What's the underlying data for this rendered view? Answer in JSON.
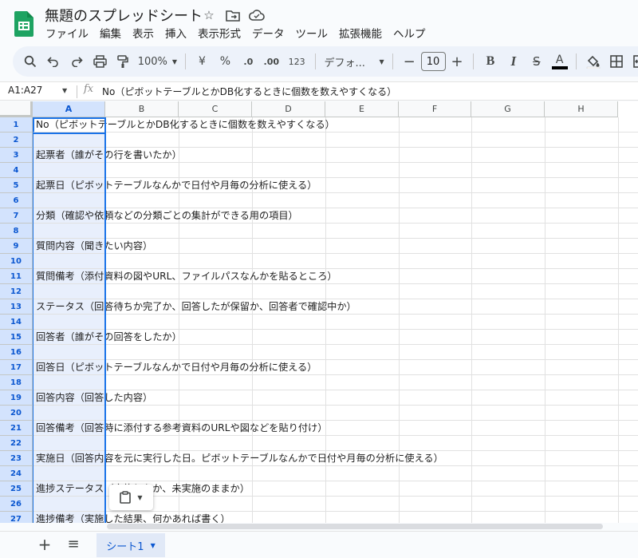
{
  "app": {
    "doc_title": "無題のスプレッドシート",
    "menu": [
      "ファイル",
      "編集",
      "表示",
      "挿入",
      "表示形式",
      "データ",
      "ツール",
      "拡張機能",
      "ヘルプ"
    ]
  },
  "toolbar": {
    "zoom": "100%",
    "currency": "¥",
    "percent": "%",
    "dec_decrease": ".0",
    "dec_increase": ".00",
    "number_format": "123",
    "font": "デフォ...",
    "font_size": "10",
    "bold": "B",
    "italic": "I",
    "strike": "S",
    "text_color": "A"
  },
  "formula_bar": {
    "name_box": "A1:A27",
    "fx": "fx",
    "content": "No（ピボットテーブルとかDB化するときに個数を数えやすくなる）"
  },
  "columns": [
    "A",
    "B",
    "C",
    "D",
    "E",
    "F",
    "G",
    "H"
  ],
  "rows": [
    {
      "num": "1",
      "text": "No（ピボットテーブルとかDB化するときに個数を数えやすくなる）"
    },
    {
      "num": "2",
      "text": ""
    },
    {
      "num": "3",
      "text": "起票者（誰がその行を書いたか）"
    },
    {
      "num": "4",
      "text": ""
    },
    {
      "num": "5",
      "text": "起票日（ピボットテーブルなんかで日付や月毎の分析に使える）"
    },
    {
      "num": "6",
      "text": ""
    },
    {
      "num": "7",
      "text": "分類（確認や依頼などの分類ごとの集計ができる用の項目）"
    },
    {
      "num": "8",
      "text": ""
    },
    {
      "num": "9",
      "text": "質問内容（聞きたい内容）"
    },
    {
      "num": "10",
      "text": ""
    },
    {
      "num": "11",
      "text": "質問備考（添付資料の図やURL、ファイルパスなんかを貼るところ）"
    },
    {
      "num": "12",
      "text": ""
    },
    {
      "num": "13",
      "text": "ステータス（回答待ちか完了か、回答したが保留か、回答者で確認中か）"
    },
    {
      "num": "14",
      "text": ""
    },
    {
      "num": "15",
      "text": "回答者（誰がその回答をしたか）"
    },
    {
      "num": "16",
      "text": ""
    },
    {
      "num": "17",
      "text": "回答日（ピボットテーブルなんかで日付や月毎の分析に使える）"
    },
    {
      "num": "18",
      "text": ""
    },
    {
      "num": "19",
      "text": "回答内容（回答した内容）"
    },
    {
      "num": "20",
      "text": ""
    },
    {
      "num": "21",
      "text": "回答備考（回答時に添付する参考資料のURLや図などを貼り付け）"
    },
    {
      "num": "22",
      "text": ""
    },
    {
      "num": "23",
      "text": "実施日（回答内容を元に実行した日。ピボットテーブルなんかで日付や月毎の分析に使える）"
    },
    {
      "num": "24",
      "text": ""
    },
    {
      "num": "25",
      "text": "進捗ステータス（実施したか、未実施のままか）"
    },
    {
      "num": "26",
      "text": ""
    },
    {
      "num": "27",
      "text": "進捗備考（実施した結果、何かあれば書く）"
    }
  ],
  "sheets": {
    "active": "シート1"
  }
}
